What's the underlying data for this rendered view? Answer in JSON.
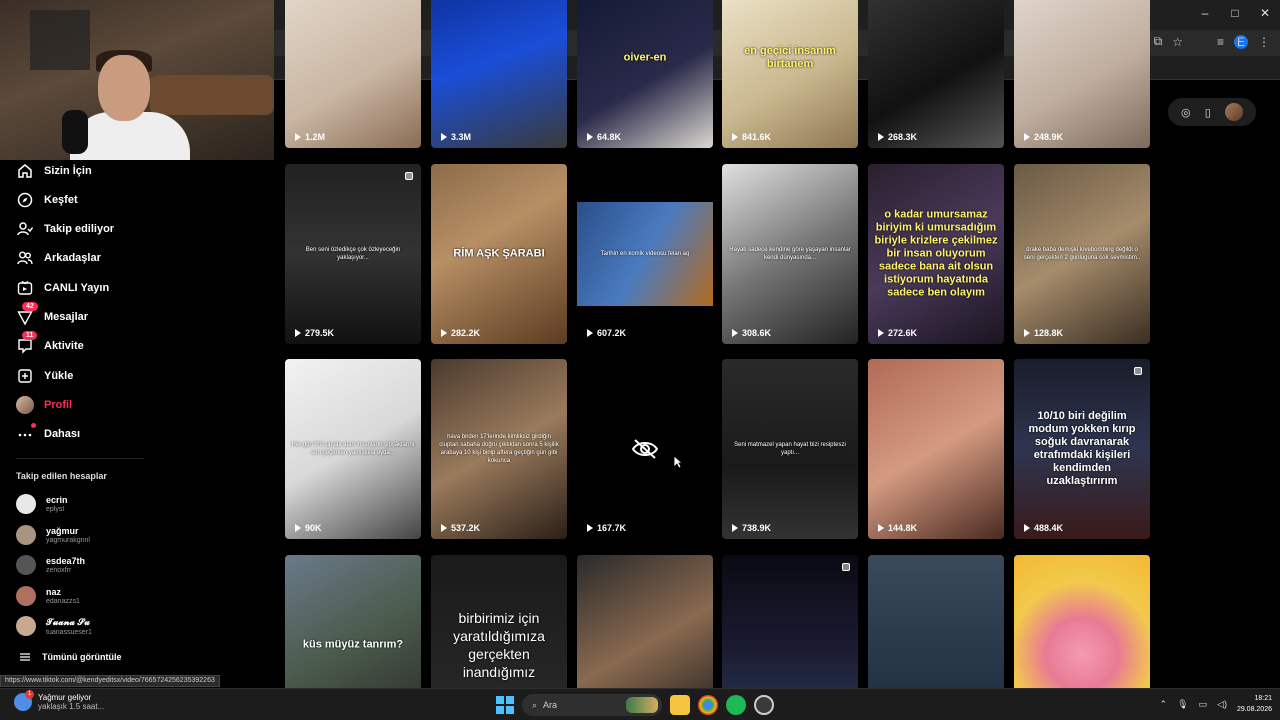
{
  "browser": {
    "window_controls": [
      "–",
      "□",
      "✕"
    ],
    "profile_initial": "E"
  },
  "sidebar": {
    "nav": [
      {
        "label": "Sizin İçin",
        "icon": "home-icon"
      },
      {
        "label": "Keşfet",
        "icon": "compass-icon"
      },
      {
        "label": "Takip ediliyor",
        "icon": "following-icon"
      },
      {
        "label": "Arkadaşlar",
        "icon": "friends-icon"
      },
      {
        "label": "CANLI Yayın",
        "icon": "live-icon"
      },
      {
        "label": "Mesajlar",
        "icon": "messages-icon",
        "badge": "42"
      },
      {
        "label": "Aktivite",
        "icon": "activity-icon",
        "badge": "11"
      },
      {
        "label": "Yükle",
        "icon": "upload-icon"
      },
      {
        "label": "Profil",
        "icon": "profile-avatar"
      },
      {
        "label": "Dahası",
        "icon": "more-icon"
      }
    ],
    "following_title": "Takip edilen hesaplar",
    "accounts": [
      {
        "name": "ecrin",
        "handle": "eplyst",
        "color": "#e8e8e8"
      },
      {
        "name": "yağmur",
        "handle": "yagmurakgnnl",
        "color": "#a89480"
      },
      {
        "name": "esdea7th",
        "handle": "zenoxfrr",
        "color": "#555555"
      },
      {
        "name": "naz",
        "handle": "edanazzs1",
        "color": "#b07060"
      },
      {
        "name": "𝓣𝓾𝓪𝓷𝓪 𝓢𝓾",
        "handle": "tuanassueser1",
        "color": "#c9a890"
      }
    ],
    "see_all": "Tümünü görüntüle"
  },
  "grid": {
    "tiles": [
      {
        "views": "1.2M",
        "bg": "linear-gradient(150deg,#e8ddd0,#c9b6a3 60%,#8a6d55)",
        "cap": ""
      },
      {
        "views": "3.3M",
        "bg": "linear-gradient(160deg,#0b2a8f,#1a4ed8 50%,#3a3a3a)",
        "cap": ""
      },
      {
        "views": "64.8K",
        "bg": "linear-gradient(150deg,#0e1630,#2a2a4a 60%,#dcd8d0)",
        "cap": "oiver-en",
        "cap_class": "big yellow"
      },
      {
        "views": "841.6K",
        "bg": "linear-gradient(150deg,#f3ead2,#c9b88f 60%,#8d7550)",
        "cap": "en geçici insanım birtanem",
        "cap_class": "big yellow"
      },
      {
        "views": "268.3K",
        "bg": "linear-gradient(150deg,#3a3a3a,#111 60%,#555)",
        "cap": ""
      },
      {
        "views": "248.9K",
        "bg": "linear-gradient(150deg,#e8ddd5,#bfae9f 60%,#7d6a5a)",
        "cap": ""
      },
      {
        "views": "279.5K",
        "bg": "linear-gradient(180deg,#222,#333 50%,#111)",
        "cap": "Ben seni özledikçe çok özleyeceğin yaklaşıyor...",
        "multi": true
      },
      {
        "views": "282.2K",
        "bg": "linear-gradient(150deg,#8d6c4a,#b68f64 40%,#5c3c22)",
        "cap": "RİM AŞK ŞARABI",
        "cap_class": "big"
      },
      {
        "views": "607.2K",
        "bg": "#000",
        "cap": "Tarihin en komik videosu felan aq",
        "inner": true
      },
      {
        "views": "308.6K",
        "bg": "linear-gradient(150deg,#e0e0e0,#777 50%,#222)",
        "cap": "Hayatı sadece kendine göre yaşayan insanlar kendi dünyasında..."
      },
      {
        "views": "272.6K",
        "bg": "linear-gradient(150deg,#2a1f2e,#4a3a5a 50%,#1b1420)",
        "cap": "o kadar umursamaz biriyim ki umursadığım biriyle krizlere çekilmez bir insan oluyorum sadece bana ait olsun istiyorum hayatında sadece ben olayım",
        "cap_class": "big yellow"
      },
      {
        "views": "128.8K",
        "bg": "linear-gradient(150deg,#6b5a45,#a58c6b 50%,#3a2e22)",
        "cap": "drake baba demişki lovebombing değildi o seni gerçekten 2 gunluguna cok sevmistim.."
      },
      {
        "views": "90K",
        "bg": "linear-gradient(150deg,#f2f2f2,#d8d8d8 50%,#444)",
        "cap": "Her gün 9:9 şipşak atan insanların şipşaklarını seri geçerken yanlışlıkla ayda..."
      },
      {
        "views": "537.2K",
        "bg": "linear-gradient(150deg,#4a3a2e,#9a7b5c 50%,#2a1f18)",
        "cap": "hava birden 17'lerinde kimliksiz girdiğin cluptan sabaha doğru çıktıktan sonra 5 kişilik arabaya 10 kişi binip aftera geçtiğin gün gibi kokunca"
      },
      {
        "views": "167.7K",
        "bg": "#000",
        "cap": "",
        "hidden": true
      },
      {
        "views": "738.9K",
        "bg": "linear-gradient(180deg,#2a2a2a,#1a1a1a 60%,#333)",
        "cap": "Seni matmazel yapan hayat bizi resipteszi yaptı..."
      },
      {
        "views": "144.8K",
        "bg": "linear-gradient(150deg,#b06a55,#d49a80 50%,#4a2a22)",
        "cap": ""
      },
      {
        "views": "488.4K",
        "bg": "linear-gradient(180deg,#1a1d2a,#2e3550 50%,#3a1a1a)",
        "cap": "10/10 biri değilim modum yokken kırıp soğuk davranarak etrafımdaki kişileri kendimden uzaklaştırırım",
        "cap_class": "big",
        "multi": true
      },
      {
        "views": "",
        "bg": "linear-gradient(150deg,#6a7a8a,#4a5a4a 50%,#2a2a2a)",
        "cap": "küs müyüz tanrım?",
        "cap_class": "big"
      },
      {
        "views": "",
        "bg": "linear-gradient(180deg,#1a1a1a,#2a2a2a)",
        "cap": "birbirimiz için yaratıldığımıza gerçekten inandığımız",
        "cap_class": "huge"
      },
      {
        "views": "",
        "bg": "linear-gradient(150deg,#2a2a2a,#8a6a50 50%,#1a1a1a)",
        "cap": ""
      },
      {
        "views": "",
        "bg": "linear-gradient(180deg,#0a0a14,#1a1a30 50%,#2a3a5a)",
        "cap": "",
        "multi": true
      },
      {
        "views": "",
        "bg": "linear-gradient(180deg,#3a4a5a,#1a2a3a)",
        "cap": ""
      },
      {
        "views": "",
        "bg": "radial-gradient(circle at 50% 55%,#f49bb0 0%,#e87a95 30%,#f2c94c 60%,#f3b931 100%)",
        "cap": ""
      }
    ]
  },
  "status_url": "https://www.tiktok.com/@kendyeditsx/video/7665724256235392263",
  "taskbar": {
    "weather_title": "Yağmur geliyor",
    "weather_sub": "yaklaşık 1.5 saat...",
    "weather_badge": "1",
    "search_placeholder": "Ara",
    "time": "18:21",
    "date": "29.08.2026"
  }
}
